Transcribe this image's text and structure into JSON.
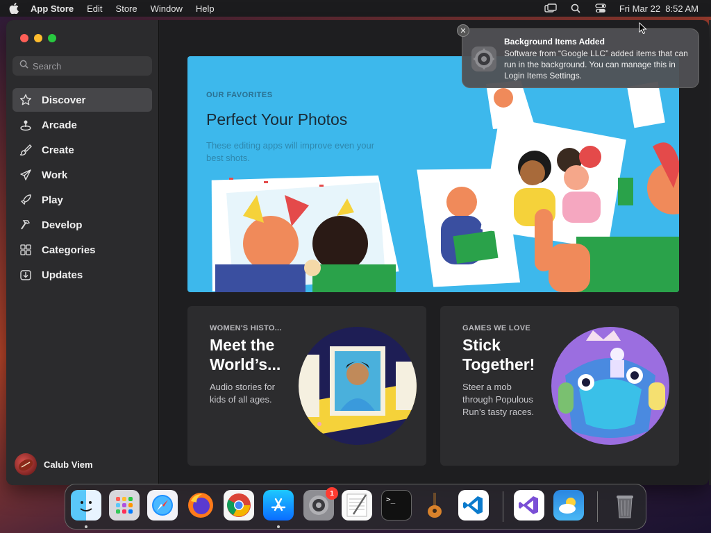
{
  "menubar": {
    "app_name": "App Store",
    "menus": [
      "Edit",
      "Store",
      "Window",
      "Help"
    ],
    "datetime": "Fri Mar 22  8:52 AM"
  },
  "sidebar": {
    "search_placeholder": "Search",
    "items": [
      {
        "label": "Discover",
        "icon": "star-icon"
      },
      {
        "label": "Arcade",
        "icon": "joystick-icon"
      },
      {
        "label": "Create",
        "icon": "brush-icon"
      },
      {
        "label": "Work",
        "icon": "paperplane-icon"
      },
      {
        "label": "Play",
        "icon": "rocket-icon"
      },
      {
        "label": "Develop",
        "icon": "hammer-icon"
      },
      {
        "label": "Categories",
        "icon": "grid-icon"
      },
      {
        "label": "Updates",
        "icon": "download-icon"
      }
    ],
    "user_name": "Calub Viem"
  },
  "hero": {
    "eyebrow": "OUR FAVORITES",
    "title": "Perfect Your Photos",
    "subtitle": "These editing apps will improve even your best shots."
  },
  "cards": [
    {
      "eyebrow": "WOMEN'S HISTO...",
      "title": "Meet the World’s...",
      "subtitle": "Audio stories for kids of all ages."
    },
    {
      "eyebrow": "GAMES WE LOVE",
      "title": "Stick Together!",
      "subtitle": "Steer a mob through Populous Run’s tasty races."
    }
  ],
  "notification": {
    "title": "Background Items Added",
    "body": "Software from “Google LLC” added items that can run in the background. You can manage this in Login Items Settings."
  },
  "dock": {
    "apps": [
      "finder",
      "launchpad",
      "safari",
      "firefox",
      "chrome",
      "app-store",
      "system-settings",
      "textedit",
      "terminal",
      "garageband",
      "vscode",
      "visual-studio",
      "weather",
      "trash"
    ],
    "settings_badge": "1"
  },
  "colors": {
    "hero_bg": "#3db8ec",
    "window_bg": "#1f1f21",
    "sidebar_bg": "#2b2b2d"
  }
}
